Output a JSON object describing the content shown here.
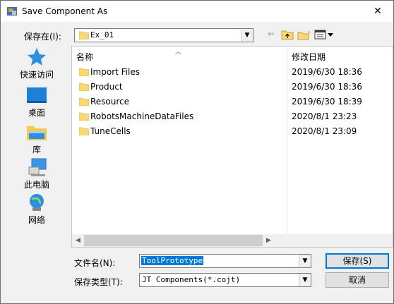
{
  "window": {
    "title": "Save Component As",
    "close_glyph": "✕"
  },
  "lookin": {
    "label": "保存在(I):",
    "value": "Ex_01"
  },
  "toolbar": {
    "back_glyph": "⇐",
    "up_glyph": "⮤",
    "newfolder_glyph": "✱",
    "view_glyph": "▦▾"
  },
  "places": [
    {
      "label": "快速访问",
      "icon": "star-icon"
    },
    {
      "label": "桌面",
      "icon": "desktop-icon"
    },
    {
      "label": "库",
      "icon": "library-icon"
    },
    {
      "label": "此电脑",
      "icon": "computer-icon"
    },
    {
      "label": "网络",
      "icon": "network-icon"
    }
  ],
  "filelist": {
    "headers": {
      "name": "名称",
      "date": "修改日期"
    },
    "rows": [
      {
        "name": "Import Files",
        "date": "2019/6/30 18:36"
      },
      {
        "name": "Product",
        "date": "2019/6/30 18:36"
      },
      {
        "name": "Resource",
        "date": "2019/6/30 18:39"
      },
      {
        "name": "RobotsMachineDataFiles",
        "date": "2020/8/1 23:23"
      },
      {
        "name": "TuneCells",
        "date": "2020/8/1 23:09"
      }
    ]
  },
  "filename": {
    "label": "文件名(N):",
    "value": "ToolPrototype"
  },
  "filetype": {
    "label": "保存类型(T):",
    "value": "JT Components(*.cojt)"
  },
  "buttons": {
    "save": "保存(S)",
    "cancel": "取消"
  },
  "colors": {
    "accent": "#0078d7",
    "folder": "#f8d775"
  }
}
